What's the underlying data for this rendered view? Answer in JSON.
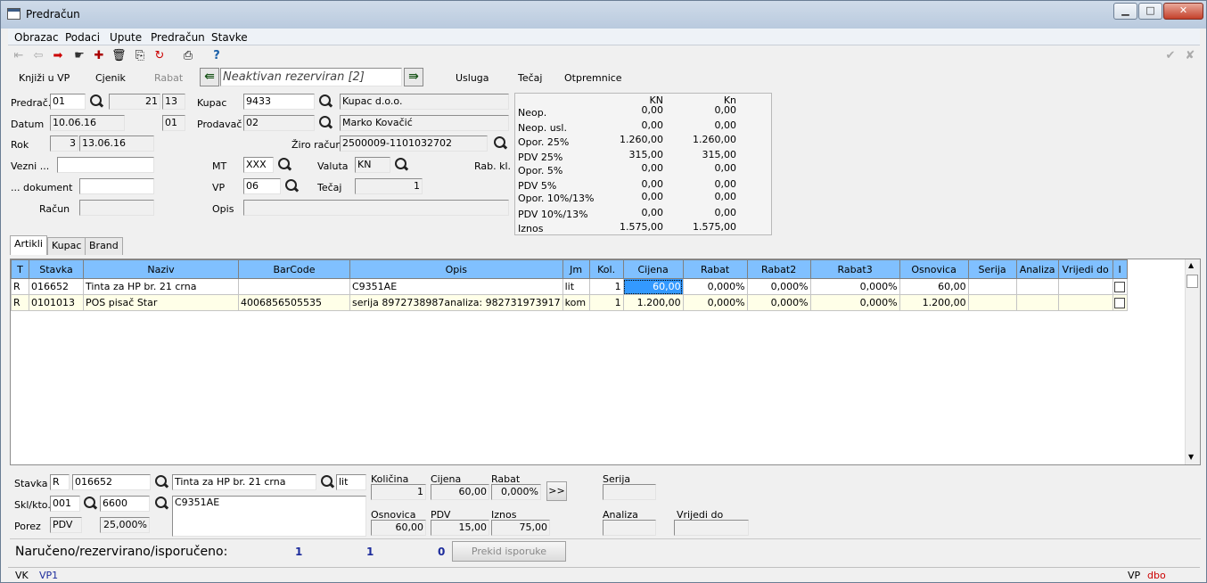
{
  "window": {
    "title": "Predračun",
    "minimize": "▁",
    "maximize": "□",
    "close": "✕"
  },
  "menu": [
    "Obrazac",
    "Podaci",
    "Upute",
    "Predračun",
    "Stavke"
  ],
  "toolbar_icons": [
    "first-icon",
    "prev-icon",
    "next-icon",
    "last-icon",
    "new-record-icon",
    "delete-icon",
    "copy-icon",
    "refresh-icon",
    "print-icon",
    "help-icon",
    "confirm-icon",
    "cancel-icon"
  ],
  "actions": {
    "knjizi": "Knjiži u VP",
    "cjenik": "Cjenik",
    "rabat": "Rabat",
    "status": "Neaktivan rezerviran [2]",
    "usluga": "Usluga",
    "tecaj": "Tečaj",
    "otpremnice": "Otpremnice"
  },
  "header": {
    "predrac_label": "Predrač.",
    "predrac_code": "01",
    "predrac_num": "21",
    "predrac_num2": "13",
    "datum_label": "Datum",
    "datum": "10.06.16",
    "datum_code": "01",
    "rok_label": "Rok",
    "rok_days": "3",
    "rok_date": "13.06.16",
    "vezni_label": "Vezni ...",
    "dokument_label": "... dokument",
    "racun_label": "Račun",
    "kupac_label": "Kupac",
    "kupac_code": "9433",
    "kupac_name": "Kupac d.o.o.",
    "prodavac_label": "Prodavač",
    "prodavac_code": "02",
    "prodavac_name": "Marko Kovačić",
    "ziro_label": "Žiro račun",
    "ziro": "2500009-1101032702",
    "mt_label": "MT",
    "mt": "XXX",
    "valuta_label": "Valuta",
    "valuta": "KN",
    "rabkl_label": "Rab. kl.",
    "vp_label": "VP",
    "vp": "06",
    "tecaj_label": "Tečaj",
    "tecaj": "1",
    "opis_label": "Opis",
    "opis": ""
  },
  "summary": {
    "col1": "KN",
    "col2": "Kn",
    "rows": [
      {
        "label": "Neop.",
        "v1": "0,00",
        "v2": "0,00"
      },
      {
        "label": "Neop. usl.",
        "v1": "0,00",
        "v2": "0,00"
      },
      {
        "label": "Opor. 25%",
        "v1": "1.260,00",
        "v2": "1.260,00"
      },
      {
        "label": "PDV 25%",
        "v1": "315,00",
        "v2": "315,00"
      },
      {
        "label": "Opor. 5%",
        "v1": "0,00",
        "v2": "0,00"
      },
      {
        "label": "PDV 5%",
        "v1": "0,00",
        "v2": "0,00"
      },
      {
        "label": "Opor. 10%/13%",
        "v1": "0,00",
        "v2": "0,00"
      },
      {
        "label": "PDV 10%/13%",
        "v1": "0,00",
        "v2": "0,00"
      },
      {
        "label": "Iznos",
        "v1": "1.575,00",
        "v2": "1.575,00"
      }
    ]
  },
  "tabs": [
    "Artikli",
    "Kupac",
    "Brand"
  ],
  "grid": {
    "columns": [
      "T",
      "Stavka",
      "Naziv",
      "BarCode",
      "Opis",
      "Jm",
      "Kol.",
      "Cijena",
      "Rabat",
      "Rabat2",
      "Rabat3",
      "Osnovica",
      "Serija",
      "Analiza",
      "Vrijedi do",
      "I"
    ],
    "rows": [
      [
        "R",
        "016652",
        "Tinta za HP br. 21 crna",
        "",
        "C9351AE",
        "lit",
        "1",
        "60,00",
        "0,000%",
        "0,000%",
        "0,000%",
        "60,00",
        "",
        "",
        "",
        ""
      ],
      [
        "R",
        "0101013",
        "POS pisač Star",
        "4006856505535",
        "serija 8972738987analiza: 982731973917",
        "kom",
        "1",
        "1.200,00",
        "0,000%",
        "0,000%",
        "0,000%",
        "1.200,00",
        "",
        "",
        "",
        ""
      ]
    ]
  },
  "detail": {
    "stavka_label": "Stavka",
    "stavka_t": "R",
    "stavka_code": "016652",
    "stavka_name": "Tinta za HP br. 21 crna",
    "stavka_jm": "lit",
    "skl_label": "Skl/kto.",
    "skl": "001",
    "kto": "6600",
    "opis": "C9351AE",
    "porez_label": "Porez",
    "porez": "PDV",
    "porez_pct": "25,000%",
    "kolicina_label": "Količina",
    "kolicina": "1",
    "cijena_label": "Cijena",
    "cijena": "60,00",
    "rabat_label": "Rabat",
    "rabat": "0,000%",
    "more": ">>",
    "osnovica_label": "Osnovica",
    "osnovica": "60,00",
    "pdv_label": "PDV",
    "pdv": "15,00",
    "iznos_label": "Iznos",
    "iznos": "75,00",
    "serija_label": "Serija",
    "analiza_label": "Analiza",
    "vrijedi_label": "Vrijedi do",
    "nar_label": "Naručeno/rezervirano/isporučeno:",
    "nar": "1",
    "rez": "1",
    "isp": "0",
    "prekid": "Prekid isporuke"
  },
  "status": {
    "left1": "VK",
    "left2": "VP1",
    "right1": "VP",
    "right2": "dbo"
  }
}
